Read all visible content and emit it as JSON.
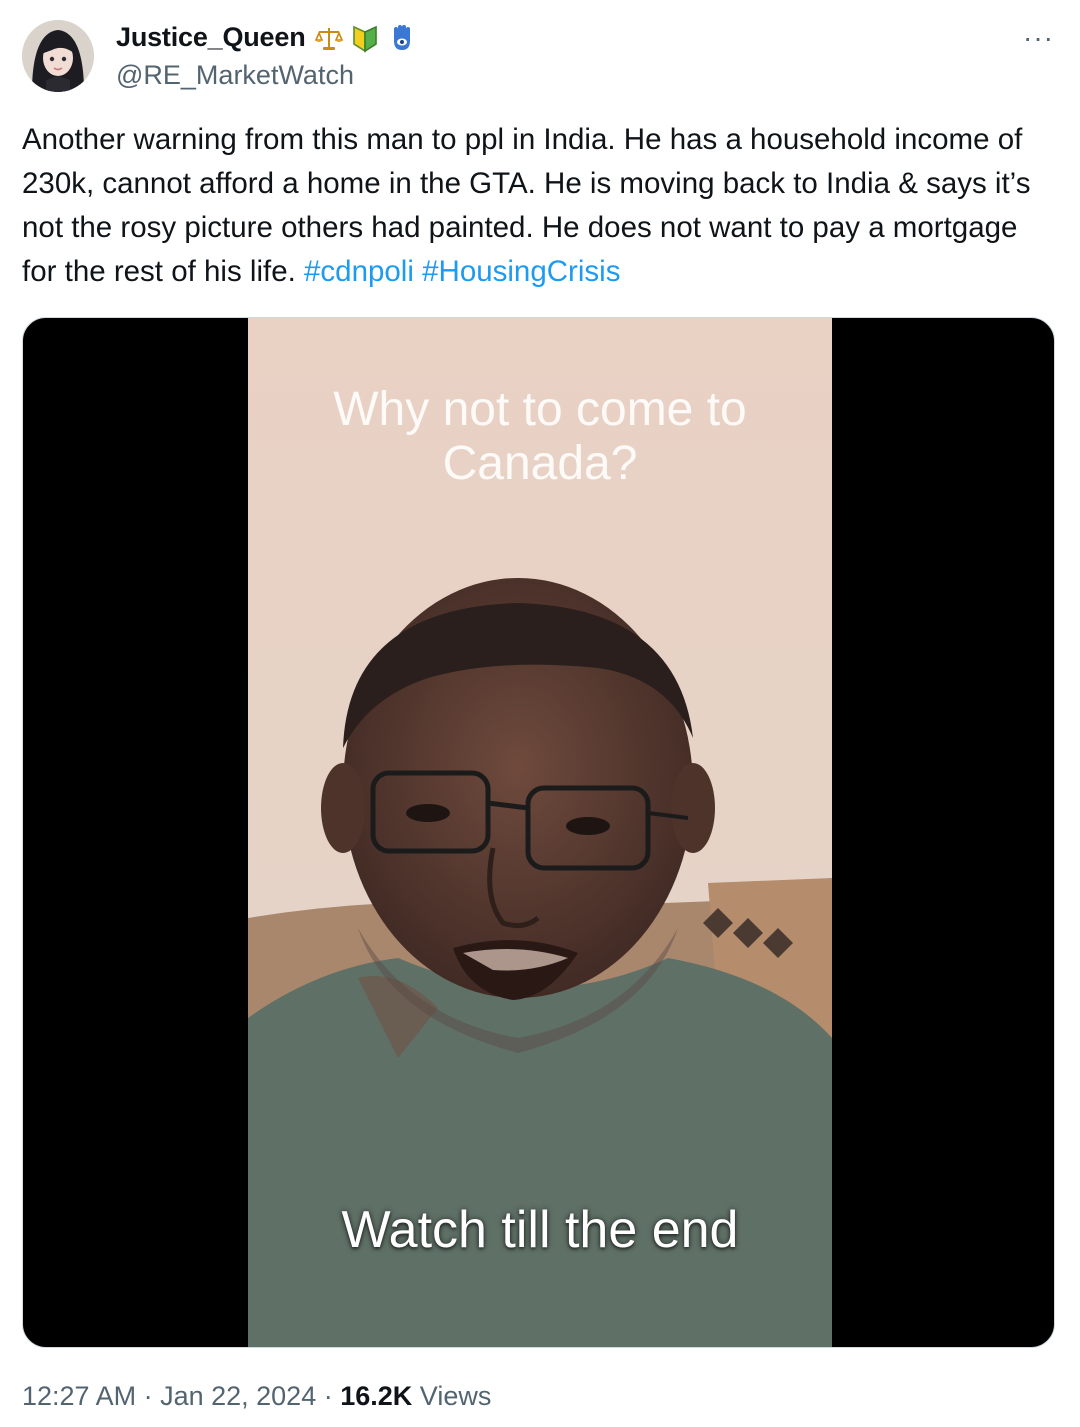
{
  "author": {
    "name": "Justice_Queen",
    "handle": "@RE_MarketWatch",
    "badges": [
      "scales-icon",
      "beginner-shield-icon",
      "hamsa-icon"
    ]
  },
  "tweet": {
    "text": "Another warning from this man to ppl in India. He has a household income of 230k, cannot afford a home in the GTA. He is moving back to India & says it’s not the rosy picture others had painted. He does not want to pay a mortgage for the rest of his life.",
    "hashtags": [
      "#cdnpoli",
      "#HousingCrisis"
    ]
  },
  "video": {
    "caption_top": "Why not to come to Canada?",
    "caption_bottom": "Watch till the end"
  },
  "meta": {
    "time": "12:27 AM",
    "separator": " · ",
    "date": "Jan 22, 2024",
    "views_count": "16.2K",
    "views_label": "Views"
  },
  "menu": {
    "more_label": "···"
  },
  "colors": {
    "link": "#1d9bf0",
    "secondary_text": "#536471",
    "primary_text": "#0f1419"
  }
}
